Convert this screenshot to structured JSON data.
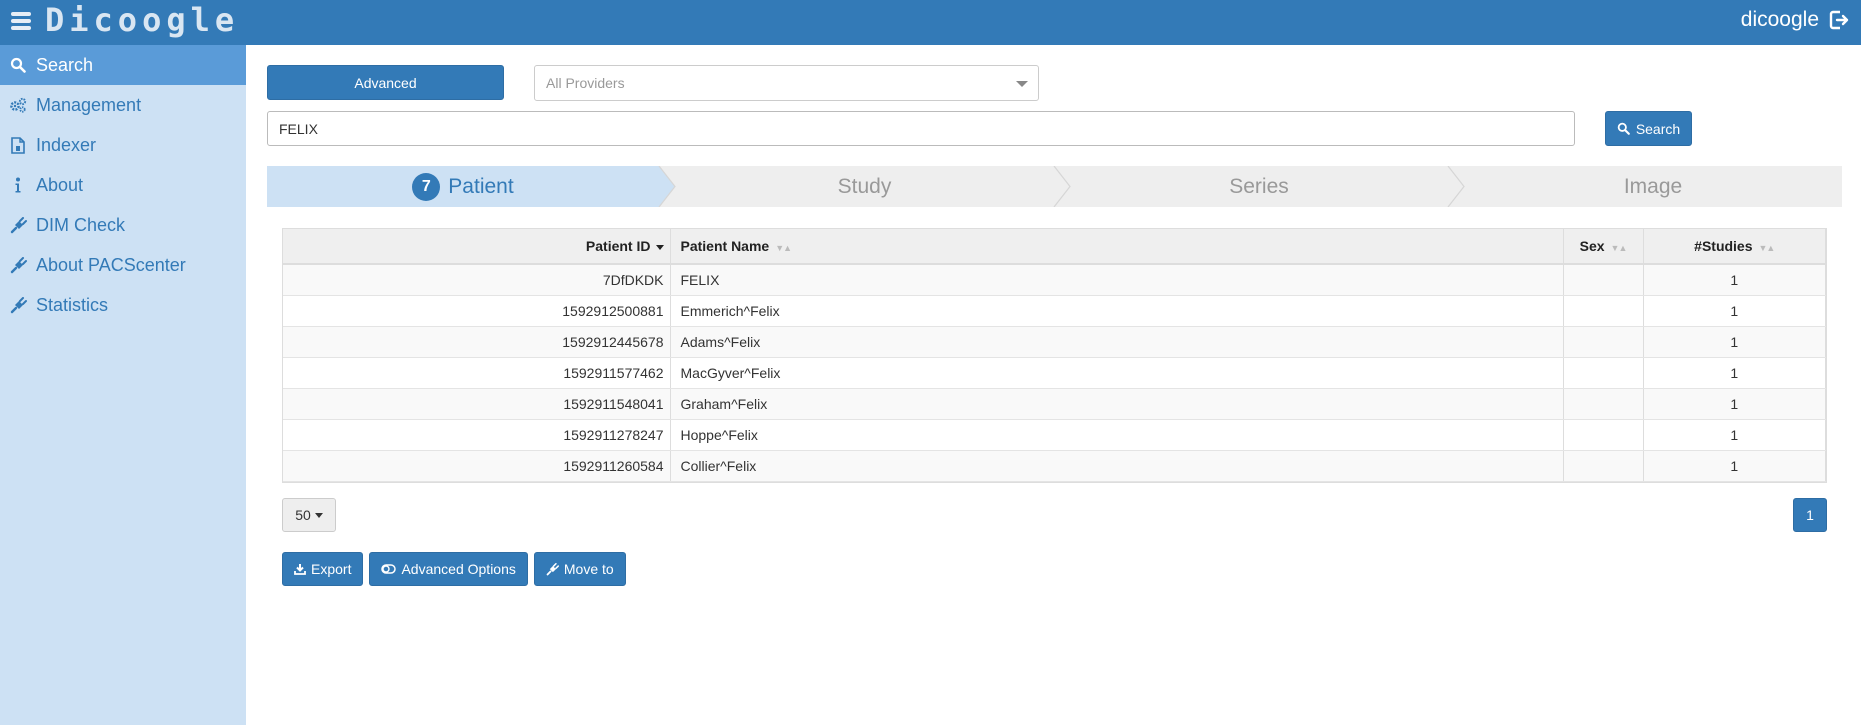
{
  "app": {
    "logo": "Dicoogle",
    "user": "dicoogle"
  },
  "sidebar": {
    "items": [
      {
        "label": "Search",
        "icon": "search-icon",
        "active": true
      },
      {
        "label": "Management",
        "icon": "gears-icon"
      },
      {
        "label": "Indexer",
        "icon": "file-icon"
      },
      {
        "label": "About",
        "icon": "info-icon"
      },
      {
        "label": "DIM Check",
        "icon": "plug-icon"
      },
      {
        "label": "About PACScenter",
        "icon": "plug-icon"
      },
      {
        "label": "Statistics",
        "icon": "plug-icon"
      }
    ]
  },
  "search": {
    "advanced_label": "Advanced",
    "providers_placeholder": "All Providers",
    "query_value": "FELIX",
    "search_label": "Search"
  },
  "steps": {
    "items": [
      {
        "label": "Patient",
        "badge": "7",
        "active": true
      },
      {
        "label": "Study"
      },
      {
        "label": "Series"
      },
      {
        "label": "Image"
      }
    ]
  },
  "table": {
    "headers": [
      "Patient ID",
      "Patient Name",
      "Sex",
      "#Studies"
    ],
    "rows": [
      [
        "7DfDKDK",
        "FELIX",
        "",
        "1"
      ],
      [
        "1592912500881",
        "Emmerich^Felix",
        "",
        "1"
      ],
      [
        "1592912445678",
        "Adams^Felix",
        "",
        "1"
      ],
      [
        "1592911577462",
        "MacGyver^Felix",
        "",
        "1"
      ],
      [
        "1592911548041",
        "Graham^Felix",
        "",
        "1"
      ],
      [
        "1592911278247",
        "Hoppe^Felix",
        "",
        "1"
      ],
      [
        "1592911260584",
        "Collier^Felix",
        "",
        "1"
      ]
    ]
  },
  "pagination": {
    "page_size": "50",
    "current_page": "1"
  },
  "actions": {
    "export_label": "Export",
    "advanced_options_label": "Advanced Options",
    "move_to_label": "Move to"
  },
  "colors": {
    "primary": "#337ab7",
    "sidebar_bg": "#cde1f4",
    "sidebar_active": "#5a9bd8",
    "step_active_bg": "#cde1f4",
    "step_bg": "#eeeeee"
  }
}
